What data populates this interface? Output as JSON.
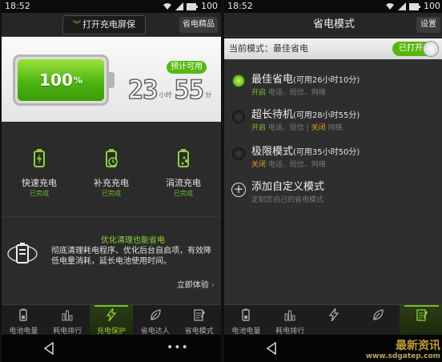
{
  "left": {
    "status": {
      "time": "18:52",
      "battery": "100"
    },
    "top": {
      "tab_label": "打开充电屏保",
      "right_button": "省电精品"
    },
    "battery": {
      "percent": "100",
      "percent_sign": "%",
      "level": 1.0,
      "estimate_badge": "预计可用",
      "hours": "23",
      "hours_unit": "小时",
      "minutes": "55",
      "minutes_unit": "分"
    },
    "features": [
      {
        "name": "快速充电",
        "status": "已完成",
        "icon": "fast-charge-icon"
      },
      {
        "name": "补充充电",
        "status": "已完成",
        "icon": "supplement-charge-icon"
      },
      {
        "name": "涓流充电",
        "status": "已完成",
        "icon": "trickle-charge-icon"
      }
    ],
    "promo": {
      "title": "优化清理也能省电",
      "desc": "彻底清理耗电程序、优化后台自启项，有效降低电量消耗，延长电池使用时间。",
      "action": "立即体验"
    },
    "nav": [
      {
        "label": "电池电量",
        "icon": "battery-icon"
      },
      {
        "label": "耗电排行",
        "icon": "bar-chart-icon"
      },
      {
        "label": "充电保护",
        "icon": "lightning-icon",
        "active": true
      },
      {
        "label": "省电达人",
        "icon": "leaf-icon"
      },
      {
        "label": "省电模式",
        "icon": "mode-icon"
      }
    ]
  },
  "right": {
    "status": {
      "time": "18:52",
      "battery": "100"
    },
    "title": "省电模式",
    "settings_button": "设置",
    "current_mode": "当前模式：最佳省电",
    "toggle_label": "已打开",
    "modes": [
      {
        "name": "最佳省电",
        "hint": "(可用26小时10分)",
        "on_label": "开启",
        "on_items": "电话、短信、网络",
        "off_label": "",
        "off_items": "",
        "selected": true
      },
      {
        "name": "超长待机",
        "hint": "(可用28小时55分)",
        "on_label": "开启",
        "on_items": "电话、短信",
        "off_label": "关闭",
        "off_items": "网络",
        "selected": false
      },
      {
        "name": "极限模式",
        "hint": "(可用35小时50分)",
        "on_label": "",
        "on_items": "",
        "off_label": "关闭",
        "off_items": "电话、短信、网络",
        "selected": false
      }
    ],
    "custom": {
      "name": "添加自定义模式",
      "desc": "定制您自己的省电模式"
    },
    "nav": [
      {
        "label": "电池电量",
        "icon": "battery-icon"
      },
      {
        "label": "耗电排行",
        "icon": "bar-chart-icon"
      },
      {
        "label": "",
        "icon": "lightning-icon"
      },
      {
        "label": "",
        "icon": "leaf-icon"
      },
      {
        "label": "",
        "icon": "mode-icon",
        "active": true
      }
    ],
    "watermark_top": "最新资讯",
    "watermark_url": "www.sdgatep.com"
  }
}
